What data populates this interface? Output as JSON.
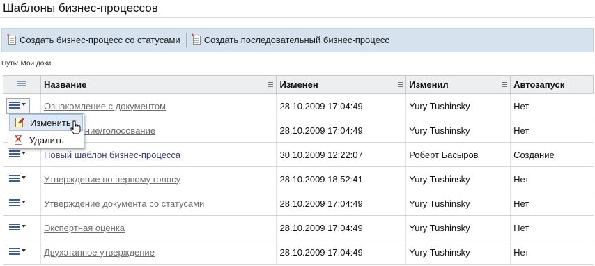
{
  "page": {
    "title": "Шаблоны бизнес-процессов"
  },
  "toolbar": {
    "create_status": "Создать бизнес-процесс со статусами",
    "create_sequential": "Создать последовательный бизнес-процесс"
  },
  "path": {
    "text": "Путь: Мои доки"
  },
  "table": {
    "headers": {
      "name": "Название",
      "modified": "Изменен",
      "modified_by": "Изменил",
      "autostart": "Автозапуск"
    },
    "rows": [
      {
        "name": "Ознакомление с документом",
        "modified": "28.10.2009 17:04:49",
        "modified_by": "Yury Tushinsky",
        "autostart": "Нет"
      },
      {
        "name": "Утверждение/голосование",
        "modified": "28.10.2009 17:04:49",
        "modified_by": "Yury Tushinsky",
        "autostart": "Нет"
      },
      {
        "name": "Новый шаблон бизнес-процесса",
        "modified": "30.10.2009 12:22:07",
        "modified_by": "Роберт Басыров",
        "autostart": "Создание"
      },
      {
        "name": "Утверждение по первому голосу",
        "modified": "28.10.2009 18:52:41",
        "modified_by": "Yury Tushinsky",
        "autostart": "Нет"
      },
      {
        "name": "Утверждение документа со статусами",
        "modified": "28.10.2009 17:04:49",
        "modified_by": "Yury Tushinsky",
        "autostart": "Нет"
      },
      {
        "name": "Экспертная оценка",
        "modified": "28.10.2009 17:04:49",
        "modified_by": "Yury Tushinsky",
        "autostart": "Нет"
      },
      {
        "name": "Двухэтапное утверждение",
        "modified": "28.10.2009 17:04:49",
        "modified_by": "Yury Tushinsky",
        "autostart": "Нет"
      }
    ]
  },
  "context_menu": {
    "edit": "Изменить",
    "delete": "Удалить"
  },
  "icons": {
    "row_menu": "menu-lines-icon",
    "create": "new-document-icon",
    "edit": "edit-document-icon",
    "delete": "delete-icon"
  }
}
